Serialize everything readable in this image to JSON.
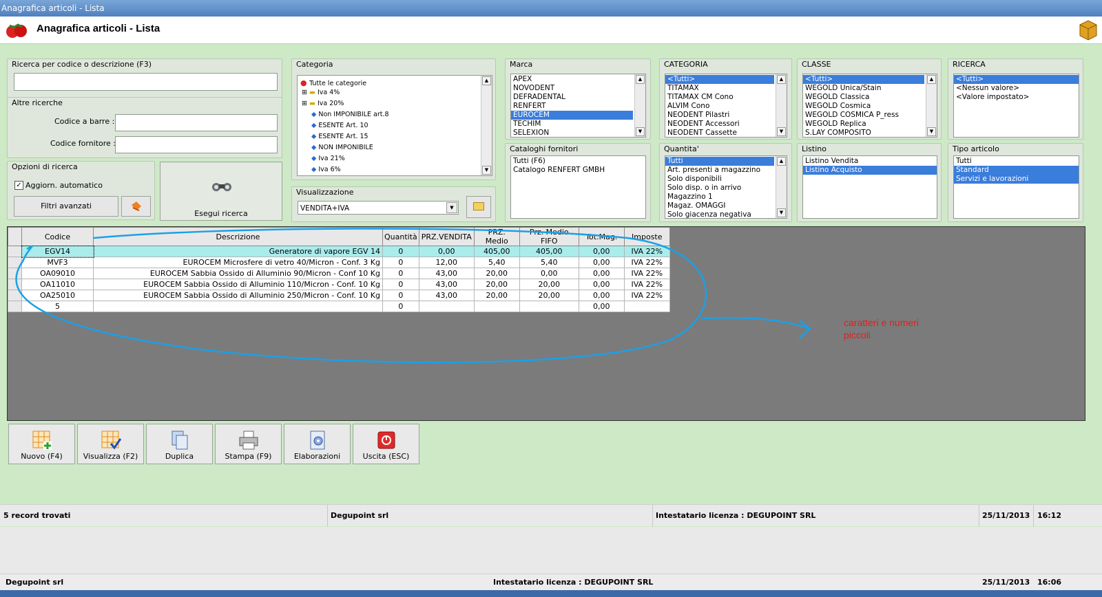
{
  "window": {
    "title": "Anagrafica articoli  - Lista",
    "heading": "Anagrafica articoli  - Lista"
  },
  "search": {
    "group_label": "Ricerca per codice o descrizione (F3)",
    "value": "",
    "other_label": "Altre ricerche",
    "barcode_label": "Codice a barre :",
    "barcode_value": "",
    "supplier_label": "Codice fornitore :",
    "supplier_value": ""
  },
  "options": {
    "group_label": "Opzioni di ricerca",
    "auto_update_label": "Aggiorn. automatico",
    "auto_update_checked": true,
    "advanced_filters_label": "Filtri avanzati",
    "execute_label": "Esegui ricerca"
  },
  "categoria_tree": {
    "label": "Categoria",
    "items": [
      "Tutte le categorie",
      "Iva 4%",
      "Iva 20%",
      "Non IMPONIBILE art.8",
      "ESENTE Art. 10",
      "ESENTE Art. 15",
      "NON IMPONIBILE",
      "Iva 21%",
      "Iva 6%"
    ]
  },
  "visualizzazione": {
    "label": "Visualizzazione",
    "value": "VENDITA+IVA"
  },
  "marca": {
    "label": "Marca",
    "items": [
      "APEX",
      "NOVODENT",
      "DEFRADENTAL",
      "RENFERT",
      "EUROCEM",
      "TECHIM",
      "SELEXION"
    ],
    "selected": 4
  },
  "cataloghi": {
    "label": "Cataloghi fornitori",
    "items": [
      "Tutti (F6)",
      "Catalogo RENFERT GMBH"
    ]
  },
  "categoria_list": {
    "label": "CATEGORIA",
    "items": [
      "<Tutti>",
      "TITAMAX",
      "TITAMAX CM Cono",
      "ALVIM Cono",
      "NEODENT Pilastri",
      "NEODENT Accessori",
      "NEODENT Cassette"
    ],
    "selected": 0
  },
  "quantita": {
    "label": "Quantita'",
    "items": [
      "Tutti",
      "Art. presenti a magazzino",
      "Solo disponibili",
      "Solo disp. o in arrivo",
      "Magazzino 1",
      "Magaz. OMAGGI",
      "Solo giacenza negativa"
    ],
    "selected": 0
  },
  "classe": {
    "label": "CLASSE",
    "items": [
      "<Tutti>",
      "WEGOLD Unica/Stain",
      "WEGOLD Classica",
      "WEGOLD Cosmica",
      "WEGOLD COSMICA P_ress",
      "WEGOLD Replica",
      "S.LAY COMPOSITO"
    ],
    "selected": 0
  },
  "listino": {
    "label": "Listino",
    "items": [
      "Listino Vendita",
      "Listino Acquisto"
    ],
    "selected": 1
  },
  "ricerca": {
    "label": "RICERCA",
    "items": [
      "<Tutti>",
      "<Nessun valore>",
      "<Valore impostato>"
    ],
    "selected": 0
  },
  "tipo_articolo": {
    "label": "Tipo articolo",
    "items": [
      "Tutti",
      "Standard",
      "Servizi e lavorazioni"
    ],
    "selected": [
      1,
      2
    ]
  },
  "table": {
    "headers": [
      "Codice",
      "Descrizione",
      "Quantità",
      "PRZ.VENDITA",
      "PRZ. Medio",
      "Prz. Medio FIFO",
      "Tot.Mag.",
      "Imposte"
    ],
    "rows": [
      [
        "EGV14",
        "Generatore di vapore EGV 14",
        "0",
        "0,00",
        "405,00",
        "405,00",
        "0,00",
        "IVA 22%"
      ],
      [
        "MVF3",
        "EUROCEM Microsfere di vetro 40/Micron - Conf. 3 Kg",
        "0",
        "12,00",
        "5,40",
        "5,40",
        "0,00",
        "IVA 22%"
      ],
      [
        "OA09010",
        "EUROCEM Sabbia Ossido di Alluminio 90/Micron - Conf 10 Kg",
        "0",
        "43,00",
        "20,00",
        "0,00",
        "0,00",
        "IVA 22%"
      ],
      [
        "OA11010",
        "EUROCEM Sabbia Ossido di Alluminio 110/Micron - Conf. 10 Kg",
        "0",
        "43,00",
        "20,00",
        "20,00",
        "0,00",
        "IVA 22%"
      ],
      [
        "OA25010",
        "EUROCEM Sabbia Ossido di Alluminio 250/Micron - Conf. 10 Kg",
        "0",
        "43,00",
        "20,00",
        "20,00",
        "0,00",
        "IVA 22%"
      ],
      [
        "5",
        "",
        "0",
        "",
        "",
        "",
        "0,00",
        ""
      ]
    ]
  },
  "annotation": {
    "line1": "caratteri e numeri",
    "line2": "piccoli",
    "color": "#e02020"
  },
  "buttons": {
    "new": "Nuovo (F4)",
    "view": "Visualizza (F2)",
    "duplicate": "Duplica",
    "print": "Stampa (F9)",
    "process": "Elaborazioni",
    "exit": "Uscita (ESC)"
  },
  "status": {
    "records": "5 record trovati",
    "company": "Degupoint srl",
    "license": "Intestatario licenza : DEGUPOINT SRL",
    "date": "25/11/2013",
    "time": "16:12"
  },
  "status2": {
    "company": "Degupoint srl",
    "license": "Intestatario licenza : DEGUPOINT SRL",
    "date": "25/11/2013",
    "time": "16:06"
  }
}
